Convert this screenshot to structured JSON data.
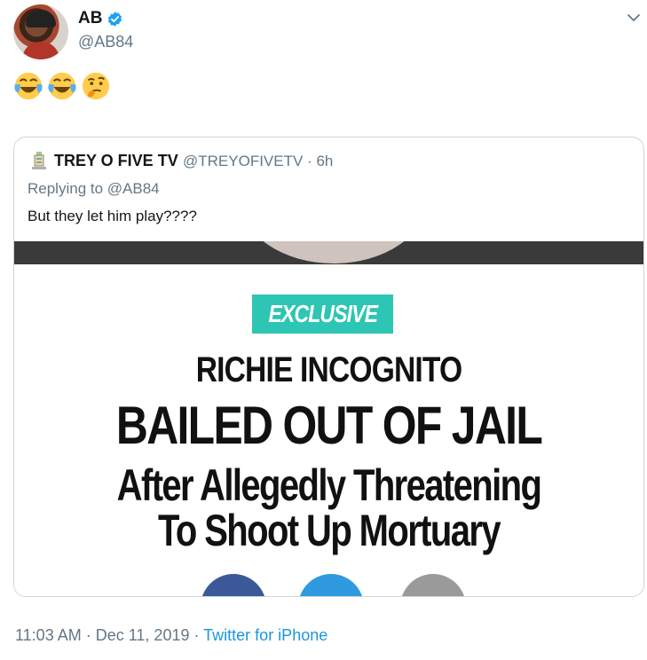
{
  "tweet": {
    "author_name": "AB",
    "author_handle": "@AB84",
    "emojis": [
      "😂",
      "😂",
      "🤔"
    ],
    "icons": [
      "verified-badge-icon",
      "chevron-down-icon"
    ],
    "accent_color": "#1da1f2"
  },
  "quoted_tweet": {
    "author_name": "TREY O FIVE TV",
    "author_handle": "@TREYOFIVETV",
    "time": "6h",
    "replying_prefix": "Replying to",
    "replying_to": "@AB84",
    "text": "But they let him play????",
    "image": {
      "badge": "EXCLUSIVE",
      "line1": "RICHIE INCOGNITO",
      "line2": "BAILED OUT OF JAIL",
      "line3": "After Allegedly Threatening",
      "line4": "To Shoot Up Mortuary",
      "badge_color": "#2dc5b3"
    }
  },
  "footer": {
    "time": "11:03 AM",
    "date": "Dec 11, 2019",
    "source": "Twitter for iPhone"
  }
}
